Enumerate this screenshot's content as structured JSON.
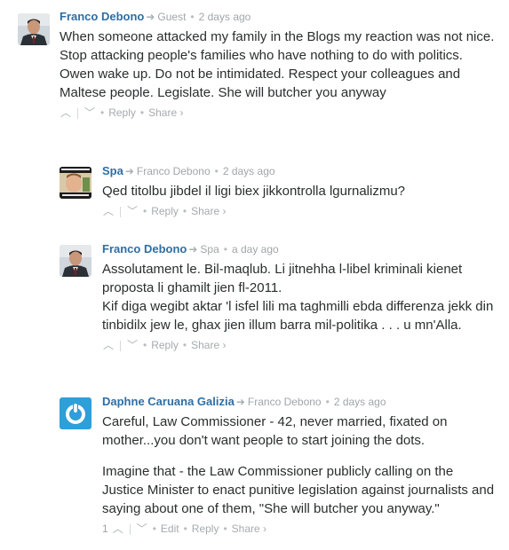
{
  "comments": [
    {
      "author": "Franco Debono",
      "parent": "Guest",
      "time": "2 days ago",
      "paragraphs": [
        "When someone attacked my family in the Blogs my reaction was not nice. Stop attacking people's families who have nothing to do with politics.",
        "Owen wake up. Do not be intimidated. Respect your colleagues and Maltese people. Legislate. She will butcher you anyway"
      ],
      "reply": "Reply",
      "share": "Share ›"
    },
    {
      "author": "Spa",
      "parent": "Franco Debono",
      "time": "2 days ago",
      "paragraphs": [
        "Qed titolbu jibdel il ligi biex jikkontrolla lgurnalizmu?"
      ],
      "reply": "Reply",
      "share": "Share ›"
    },
    {
      "author": "Franco Debono",
      "parent": "Spa",
      "time": "a day ago",
      "paragraphs": [
        "Assolutament le. Bil-maqlub. Li jitnehha l-libel kriminali kienet proposta li ghamilt jien fl-2011.",
        "Kif diga wegibt aktar 'l isfel lili ma taghmilli ebda differenza jekk din tinbidilx jew le, ghax jien illum barra mil-politika . . . u mn'Alla."
      ],
      "reply": "Reply",
      "share": "Share ›"
    },
    {
      "author": "Daphne Caruana Galizia",
      "parent": "Franco Debono",
      "time": "2 days ago",
      "paragraphs": [
        "Careful, Law Commissioner - 42, never married, fixated on mother...you don't want people to start joining the dots.",
        "Imagine that - the Law Commissioner publicly calling on the Justice Minister to enact punitive legislation against journalists and saying about one of them, \"She will butcher you anyway.\""
      ],
      "upvotes": "1",
      "edit": "Edit",
      "reply": "Reply",
      "share": "Share ›"
    }
  ],
  "colors": {
    "author": "#2e6ea4",
    "meta": "#a0a6a9",
    "text": "#2a2e2e",
    "logo": "#2e9fd8"
  },
  "icons": [
    "reply-arrow-icon",
    "upvote-icon",
    "downvote-icon"
  ]
}
